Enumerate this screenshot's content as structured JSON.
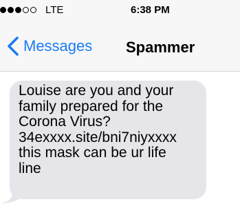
{
  "status_bar": {
    "signal_dots_filled": 3,
    "signal_dots_total": 5,
    "carrier": "LTE",
    "time": "6:38 PM"
  },
  "nav": {
    "back_label": "Messages",
    "back_icon": "chevron-left-icon",
    "contact_name": "Spammer"
  },
  "messages": [
    {
      "direction": "incoming",
      "text": "Louise are you and your\nfamily prepared for the\nCorona Virus?\n34exxxx.site/bni7niyxxxx\nthis mask can be ur life\nline"
    }
  ],
  "colors": {
    "accent": "#1a7cf5",
    "bubble_incoming": "#e5e5ea",
    "bar_background": "#f7f7f7"
  }
}
